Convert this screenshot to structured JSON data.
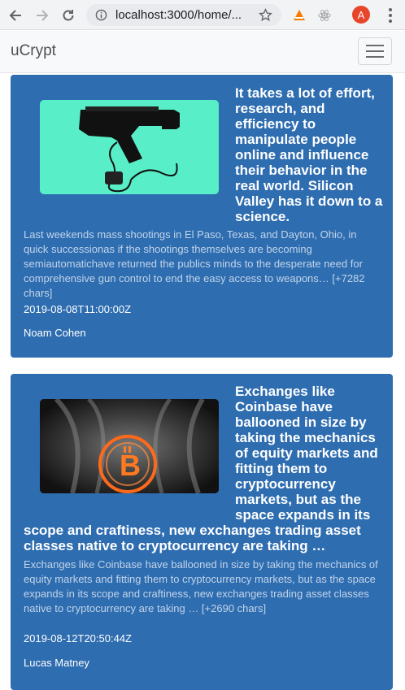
{
  "browser": {
    "url": "localhost:3000/home/..."
  },
  "navbar": {
    "brand": "uCrypt"
  },
  "articles": [
    {
      "title": "It takes a lot of effort, research, and efficiency to manipulate people online and influence their behavior in the real world. Silicon Valley has it down to a science.",
      "description": "Last weekends mass shootings in El Paso, Texas, and Dayton, Ohio, in quick successionas if the shootings themselves are becoming semiautomatichave returned the publics minds to the desperate need for comprehensive gun control to end the easy access to weapons… [+7282 chars]",
      "published_at": "2019-08-08T11:00:00Z",
      "author": "Noam Cohen",
      "image_icon": "light-gun-icon"
    },
    {
      "title": "Exchanges like Coinbase have ballooned in size by taking the mechanics of equity markets and fitting them to cryptocurrency markets, but as the space expands in its scope and craftiness, new exchanges trading asset classes native to cryptocurrency are taking …",
      "description": "Exchanges like Coinbase have ballooned in size by taking the mechanics of equity markets and fitting them to cryptocurrency markets, but as the space expands in its scope and craftiness, new exchanges trading asset classes native to cryptocurrency are taking … [+2690 chars]",
      "published_at": "2019-08-12T20:50:44Z",
      "author": "Lucas Matney",
      "image_icon": "bitcoin-xray-icon"
    }
  ],
  "colors": {
    "card_bg": "#2e6db0",
    "thumb1_bg": "#58efc8"
  }
}
